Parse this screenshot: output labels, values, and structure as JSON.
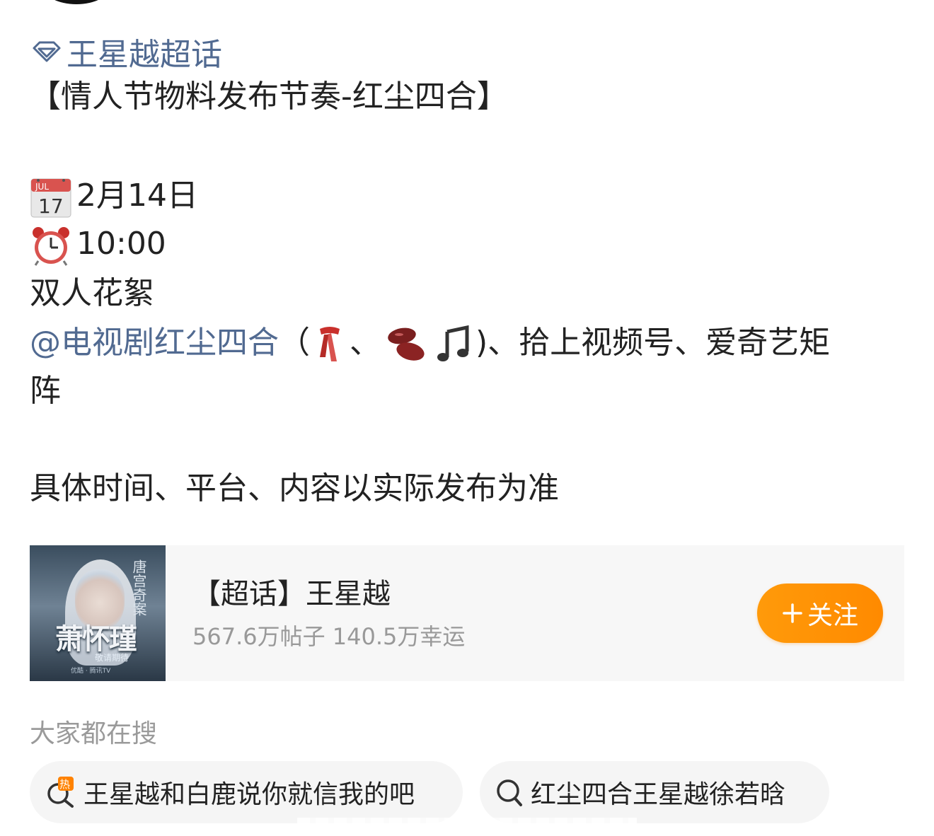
{
  "post": {
    "supertopic_link": "王星越超话",
    "title": "【情人节物料发布节奏-红尘四合】",
    "date_label": "2月14日",
    "calendar_emoji": {
      "month": "JUL",
      "day": "17"
    },
    "time_label": "10:00",
    "content_type": "双人花絮",
    "mention": "@电视剧红尘四合",
    "platform_open": "（",
    "platform_sep": "、",
    "platform_rest": ")、拾上视频号、爱奇艺矩",
    "platform_wrap": "阵",
    "note": "具体时间、平台、内容以实际发布为准"
  },
  "card": {
    "thumbnail_side_text": "唐宫奇案",
    "thumbnail_title": "萧怀瑾",
    "thumbnail_subtitle": "敬请期待",
    "thumbnail_footer": "优酷 · 腾讯TV",
    "title": "【超话】王星越",
    "stats": "567.6万帖子 140.5万幸运",
    "follow_label": "关注",
    "follow_color": "#ff9200"
  },
  "search": {
    "section_title": "大家都在搜",
    "items": [
      {
        "label": "王星越和白鹿说你就信我的吧",
        "icon": "hot-search-icon"
      },
      {
        "label": "红尘四合王星越徐若晗",
        "icon": "search-icon"
      }
    ]
  },
  "colors": {
    "link": "#516a91",
    "accent": "#ff9200"
  }
}
